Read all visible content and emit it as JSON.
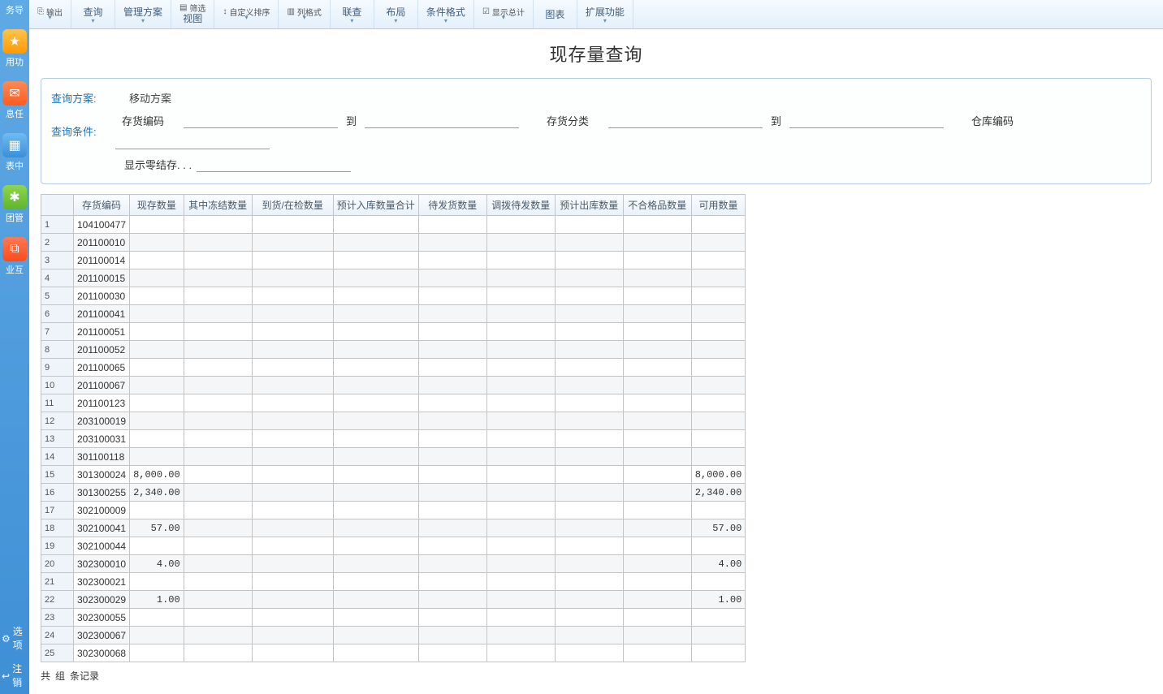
{
  "sidebar": {
    "items": [
      {
        "label": "务导"
      },
      {
        "label": "用功"
      },
      {
        "label": "息任"
      },
      {
        "label": "表中"
      },
      {
        "label": "团管"
      },
      {
        "label": "业互"
      }
    ],
    "foot": {
      "options": "选项",
      "logout": "注销"
    }
  },
  "toolbar": {
    "export_top": "输出",
    "query": "查询",
    "manage_plan": "管理方案",
    "fill_top": "筛选",
    "view": "视图",
    "custom_sort_top": "自定义排序",
    "col_format_top": "列格式",
    "link_check": "联查",
    "layout": "布局",
    "cond_format": "条件格式",
    "show_total_top": "显示总计",
    "chart": "图表",
    "ext_func": "扩展功能"
  },
  "page_title": "现存量查询",
  "query_panel": {
    "plan_label": "查询方案:",
    "plan_value": "移动方案",
    "cond_label": "查询条件:",
    "stock_code": "存货编码",
    "to": "到",
    "stock_cat": "存货分类",
    "to2": "到",
    "wh_code": "仓库编码",
    "zero_stock": "显示零结存. . ."
  },
  "table": {
    "headers": [
      "存货编码",
      "现存数量",
      "其中冻结数量",
      "到货/在检数量",
      "预计入库数量合计",
      "待发货数量",
      "调拨待发数量",
      "预计出库数量",
      "不合格品数量",
      "可用数量"
    ],
    "rows": [
      {
        "n": 1,
        "code": "104100477"
      },
      {
        "n": 2,
        "code": "201100010"
      },
      {
        "n": 3,
        "code": "201100014"
      },
      {
        "n": 4,
        "code": "201100015"
      },
      {
        "n": 5,
        "code": "201100030"
      },
      {
        "n": 6,
        "code": "201100041"
      },
      {
        "n": 7,
        "code": "201100051"
      },
      {
        "n": 8,
        "code": "201100052"
      },
      {
        "n": 9,
        "code": "201100065"
      },
      {
        "n": 10,
        "code": "201100067"
      },
      {
        "n": 11,
        "code": "201100123"
      },
      {
        "n": 12,
        "code": "203100019"
      },
      {
        "n": 13,
        "code": "203100031"
      },
      {
        "n": 14,
        "code": "301100118"
      },
      {
        "n": 15,
        "code": "301300024",
        "current": "8,000.00",
        "avail": "8,000.00"
      },
      {
        "n": 16,
        "code": "301300255",
        "current": "2,340.00",
        "avail": "2,340.00"
      },
      {
        "n": 17,
        "code": "302100009"
      },
      {
        "n": 18,
        "code": "302100041",
        "current": "57.00",
        "avail": "57.00"
      },
      {
        "n": 19,
        "code": "302100044"
      },
      {
        "n": 20,
        "code": "302300010",
        "current": "4.00",
        "avail": "4.00"
      },
      {
        "n": 21,
        "code": "302300021"
      },
      {
        "n": 22,
        "code": "302300029",
        "current": "1.00",
        "avail": "1.00"
      },
      {
        "n": 23,
        "code": "302300055"
      },
      {
        "n": 24,
        "code": "302300067"
      },
      {
        "n": 25,
        "code": "302300068"
      }
    ]
  },
  "footer": {
    "t1": "共",
    "t3": "组",
    "t5": "条记录"
  }
}
